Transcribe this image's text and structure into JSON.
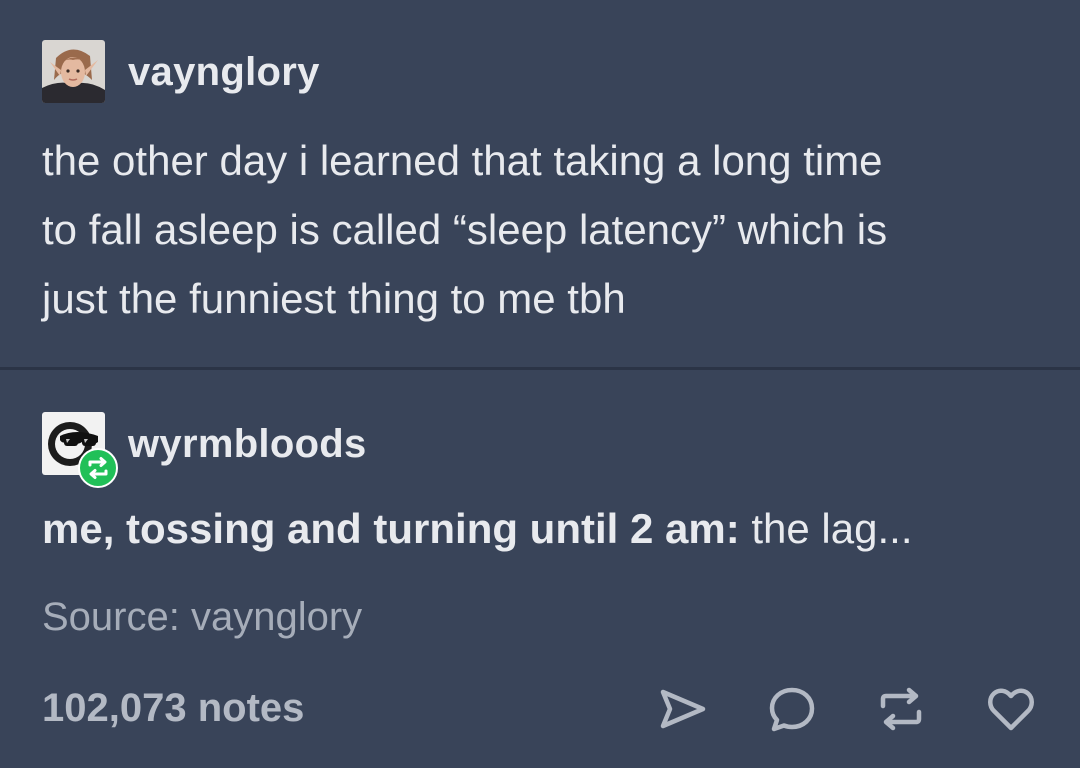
{
  "original_post": {
    "username": "vaynglory",
    "avatar_icon": "avatar-portrait-icon",
    "text_lines": [
      "the other day i learned that taking a long time",
      "to fall asleep is called “sleep latency” which is",
      "just the funniest thing to me tbh"
    ]
  },
  "reblog": {
    "username": "wyrmbloods",
    "avatar_icon": "sunglasses-avatar-icon",
    "badge_icon": "reblog-icon",
    "badge_color": "#21c058",
    "reply_bold": "me, tossing and turning until 2 am:",
    "reply_regular": " the lag..."
  },
  "source": "Source: vaynglory",
  "footer": {
    "notes": "102,073 notes",
    "actions": [
      "share-icon",
      "reply-icon",
      "reblog-icon",
      "like-icon"
    ]
  },
  "colors": {
    "background": "#394459",
    "divider": "#2b3446",
    "text": "#e8eaee",
    "muted_text": "#a6adb9"
  }
}
